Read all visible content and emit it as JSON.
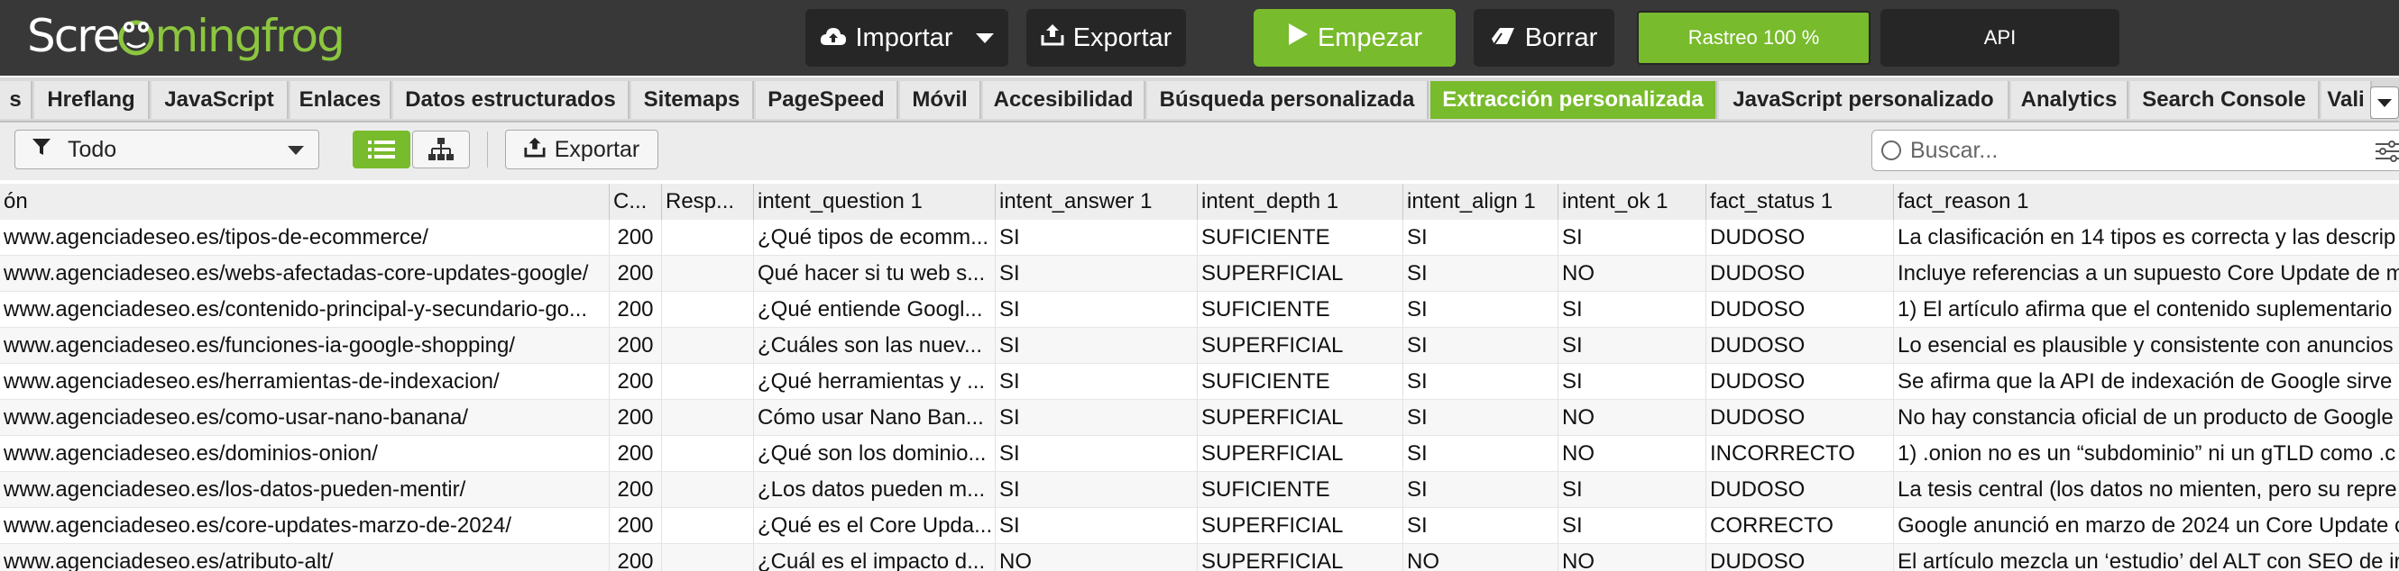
{
  "app": {
    "logo_part1": "Scre",
    "logo_part2": "mingfrog",
    "import_label": "Importar",
    "export_label": "Exportar",
    "start_label": "Empezar",
    "clear_label": "Borrar",
    "crawl_status": "Rastreo 100 %",
    "crawl_progress_fraction": 1.0,
    "api_label": "API"
  },
  "tabs": [
    {
      "label": "s"
    },
    {
      "label": "Hreflang"
    },
    {
      "label": "JavaScript"
    },
    {
      "label": "Enlaces"
    },
    {
      "label": "Datos estructurados"
    },
    {
      "label": "Sitemaps"
    },
    {
      "label": "PageSpeed"
    },
    {
      "label": "Móvil"
    },
    {
      "label": "Accesibilidad"
    },
    {
      "label": "Búsqueda personalizada"
    },
    {
      "label": "Extracción personalizada"
    },
    {
      "label": "JavaScript personalizado"
    },
    {
      "label": "Analytics"
    },
    {
      "label": "Search Console"
    },
    {
      "label": "Vali"
    }
  ],
  "active_tab": "Extracción personalizada",
  "toolbar": {
    "filter_value": "Todo",
    "export_label": "Exportar",
    "search_placeholder": "Buscar..."
  },
  "table": {
    "columns": [
      "ón",
      "C...",
      "Resp...",
      "intent_question 1",
      "intent_answer 1",
      "intent_depth 1",
      "intent_align 1",
      "intent_ok 1",
      "fact_status 1",
      "fact_reason 1"
    ],
    "rows": [
      [
        "www.agenciadeseo.es/tipos-de-ecommerce/",
        "200",
        "",
        "¿Qué tipos de ecomm...",
        "SI",
        "SUFICIENTE",
        "SI",
        "SI",
        "DUDOSO",
        "La clasificación en 14 tipos es correcta y las descrip"
      ],
      [
        "www.agenciadeseo.es/webs-afectadas-core-updates-google/",
        "200",
        "",
        "Qué hacer si tu web s...",
        "SI",
        "SUPERFICIAL",
        "SI",
        "NO",
        "DUDOSO",
        "Incluye referencias a un supuesto Core Update de m"
      ],
      [
        "www.agenciadeseo.es/contenido-principal-y-secundario-go...",
        "200",
        "",
        "¿Qué entiende Googl...",
        "SI",
        "SUFICIENTE",
        "SI",
        "SI",
        "DUDOSO",
        "1) El artículo afirma que el contenido suplementario"
      ],
      [
        "www.agenciadeseo.es/funciones-ia-google-shopping/",
        "200",
        "",
        "¿Cuáles son las nuev...",
        "SI",
        "SUPERFICIAL",
        "SI",
        "SI",
        "DUDOSO",
        "Lo esencial es plausible y consistente con anuncios"
      ],
      [
        "www.agenciadeseo.es/herramientas-de-indexacion/",
        "200",
        "",
        "¿Qué herramientas y ...",
        "SI",
        "SUFICIENTE",
        "SI",
        "SI",
        "DUDOSO",
        "Se afirma que la API de indexación de Google sirve p"
      ],
      [
        "www.agenciadeseo.es/como-usar-nano-banana/",
        "200",
        "",
        "Cómo usar Nano Ban...",
        "SI",
        "SUPERFICIAL",
        "SI",
        "NO",
        "DUDOSO",
        "No hay constancia oficial de un producto de Google"
      ],
      [
        "www.agenciadeseo.es/dominios-onion/",
        "200",
        "",
        "¿Qué son los dominio...",
        "SI",
        "SUPERFICIAL",
        "SI",
        "NO",
        "INCORRECTO",
        "1) .onion no es un “subdominio” ni un gTLD como .c"
      ],
      [
        "www.agenciadeseo.es/los-datos-pueden-mentir/",
        "200",
        "",
        "¿Los datos pueden m...",
        "SI",
        "SUFICIENTE",
        "SI",
        "SI",
        "DUDOSO",
        "La tesis central (los datos no mienten, pero su repre"
      ],
      [
        "www.agenciadeseo.es/core-updates-marzo-de-2024/",
        "200",
        "",
        "¿Qué es el Core Upda...",
        "SI",
        "SUPERFICIAL",
        "SI",
        "SI",
        "CORRECTO",
        "Google anunció en marzo de 2024 un Core Update c"
      ],
      [
        "www.agenciadeseo.es/atributo-alt/",
        "200",
        "",
        "¿Cuál es el impacto d...",
        "NO",
        "SUPERFICIAL",
        "NO",
        "NO",
        "DUDOSO",
        "El artículo mezcla un ‘estudio’ del ALT con SEO de ir"
      ]
    ]
  },
  "colors": {
    "accent_green": "#78bb2c",
    "topbar_bg": "#383838",
    "button_dark": "#262626"
  },
  "icons": [
    "frog-logo-icon",
    "cloud-upload-icon",
    "export-icon",
    "play-icon",
    "eraser-icon",
    "filter-icon",
    "list-view-icon",
    "tree-view-icon",
    "search-icon",
    "sliders-icon",
    "chevron-down-icon"
  ]
}
